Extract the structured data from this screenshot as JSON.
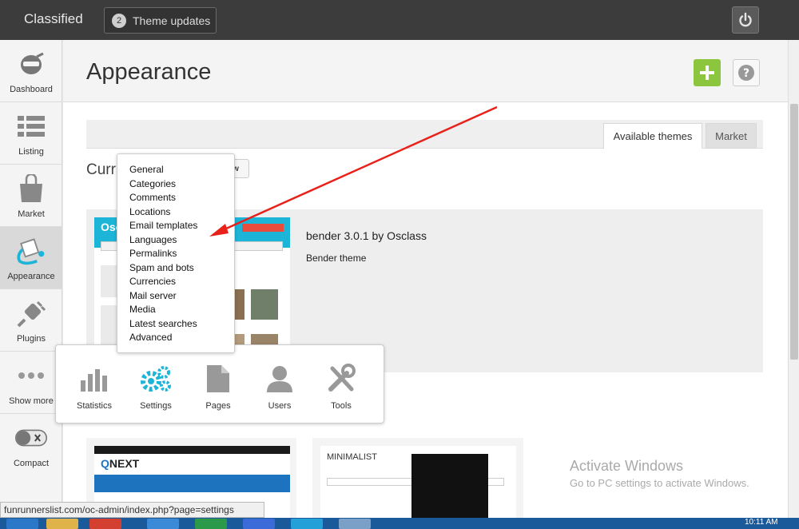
{
  "topbar": {
    "brand": "Classified",
    "theme_updates_count": "2",
    "theme_updates_label": "Theme updates"
  },
  "sidebar": {
    "items": [
      {
        "label": "Dashboard",
        "icon": "dashboard-icon"
      },
      {
        "label": "Listing",
        "icon": "listing-icon"
      },
      {
        "label": "Market",
        "icon": "market-bag-icon"
      },
      {
        "label": "Appearance",
        "icon": "paint-bucket-icon"
      },
      {
        "label": "Plugins",
        "icon": "plug-icon"
      },
      {
        "label": "Show more",
        "icon": "more-dots-icon"
      },
      {
        "label": "Compact",
        "icon": "toggle-icon"
      }
    ]
  },
  "page": {
    "title": "Appearance",
    "tabs": [
      "Available themes",
      "Market"
    ],
    "current_label": "Curr",
    "preview_label": "w",
    "theme_name": "bender 3.0.1 by Osclass",
    "theme_desc": "Bender theme",
    "thumb_title": "Osc",
    "thumb2_brand": "NEXT",
    "thumb3_title": "MINIMALIST"
  },
  "more_menu": {
    "items": [
      "Statistics",
      "Settings",
      "Pages",
      "Users",
      "Tools"
    ]
  },
  "settings_menu": {
    "items": [
      "General",
      "Categories",
      "Comments",
      "Locations",
      "Email templates",
      "Languages",
      "Permalinks",
      "Spam and bots",
      "Currencies",
      "Mail server",
      "Media",
      "Latest searches",
      "Advanced"
    ]
  },
  "watermark": {
    "line1": "Activate Windows",
    "line2": "Go to PC settings to activate Windows."
  },
  "status_url": "funrunnerslist.com/oc-admin/index.php?page=settings",
  "clock": "10:11 AM",
  "colors": {
    "topbar": "#3c3c3c",
    "accent_blue": "#1cb5d8",
    "add_green": "#8cc63f",
    "arrow_red": "#e8211a"
  }
}
